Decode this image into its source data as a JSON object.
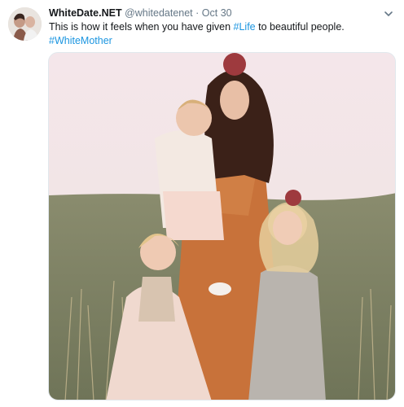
{
  "tweet": {
    "author_name": "WhiteDate.NET",
    "author_handle": "@whitedatenet",
    "separator": "·",
    "date": "Oct 30",
    "text_before": "This is how it feels when you have given ",
    "hashtag_life": "#Life",
    "text_after": " to beautiful people.",
    "hashtag_whitemother": "#WhiteMother"
  },
  "icons": {
    "avatar": "profile-avatar",
    "menu": "chevron-down-icon"
  },
  "colors": {
    "link": "#1b95e0",
    "secondary_text": "#657786",
    "primary_text": "#14171a"
  }
}
